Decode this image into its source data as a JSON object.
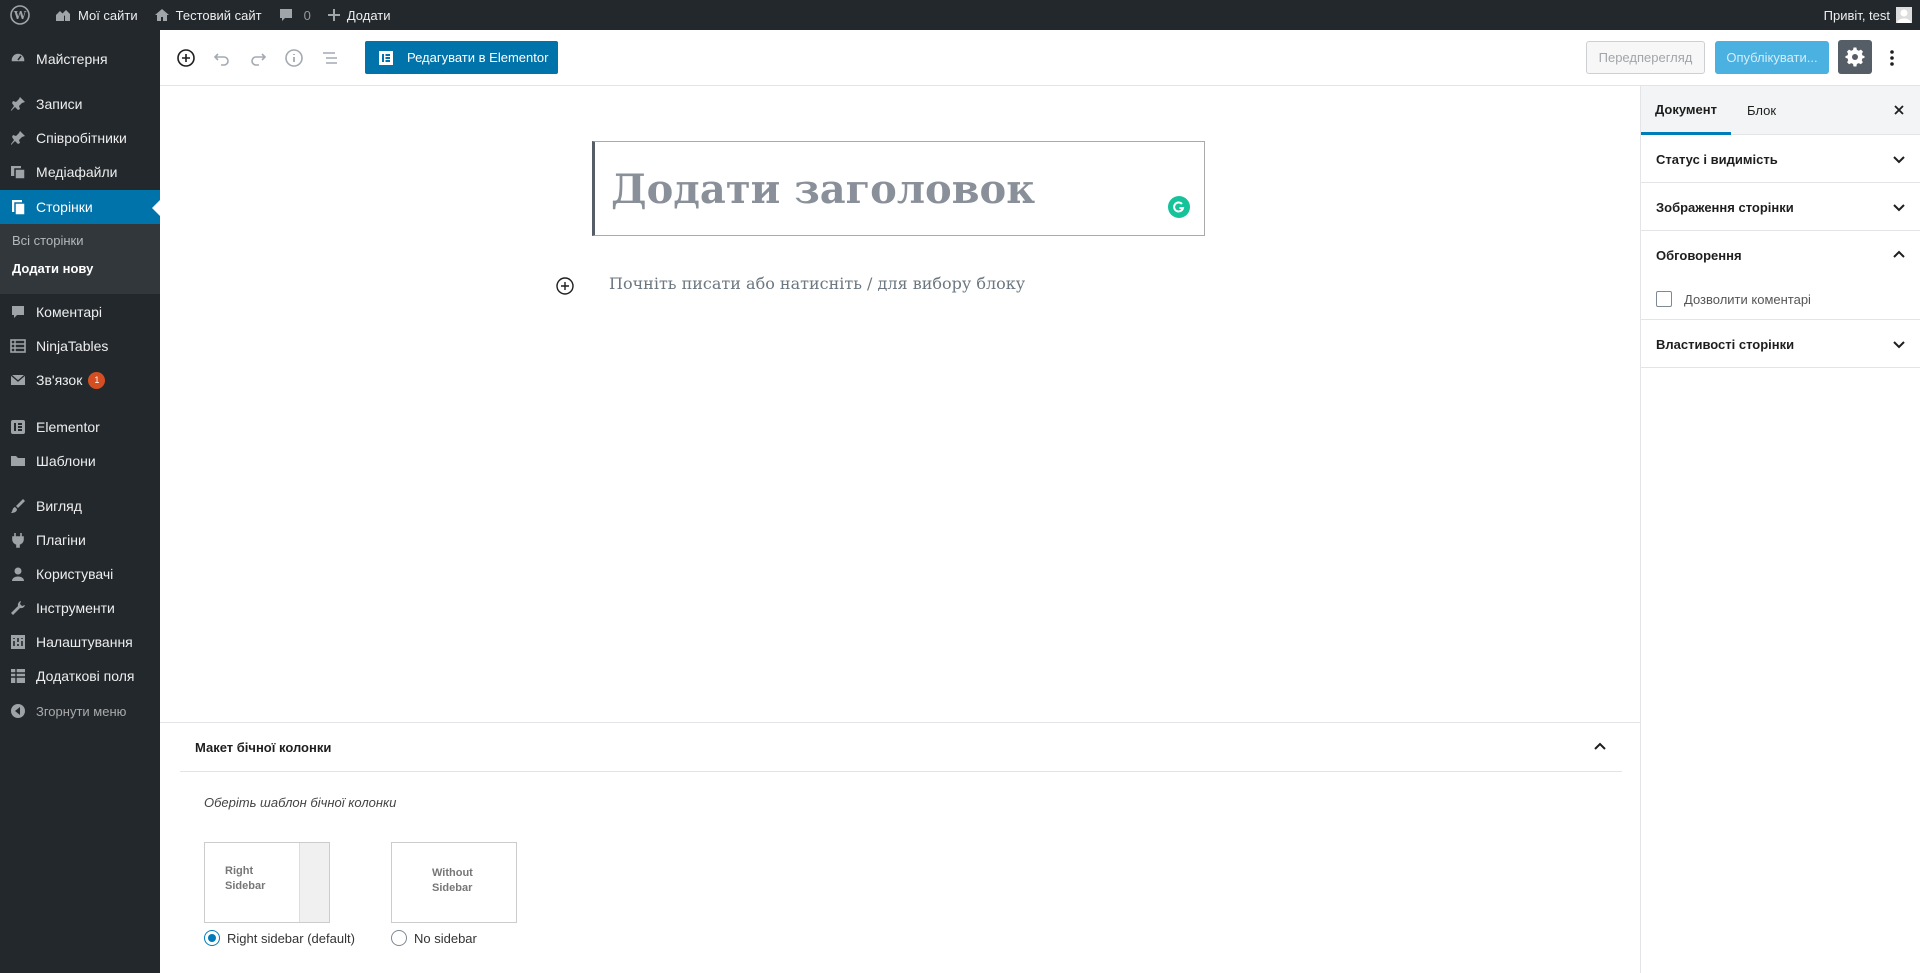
{
  "admin_bar": {
    "my_sites": "Мої сайти",
    "site_name": "Тестовий сайт",
    "comments_count": "0",
    "new_label": "Додати",
    "greeting": "Привіт, test"
  },
  "admin_menu": {
    "items": [
      {
        "label": "Майстерня",
        "icon": "dashboard-icon"
      },
      {
        "label": "Записи",
        "icon": "pin-icon"
      },
      {
        "label": "Співробітники",
        "icon": "pin-icon"
      },
      {
        "label": "Медіафайли",
        "icon": "media-icon"
      },
      {
        "label": "Сторінки",
        "icon": "pages-icon"
      },
      {
        "label": "Коментарі",
        "icon": "comment-icon"
      },
      {
        "label": "NinjaTables",
        "icon": "table-icon"
      },
      {
        "label": "Зв'язок",
        "icon": "mail-icon",
        "badge": "1"
      },
      {
        "label": "Elementor",
        "icon": "elementor-icon"
      },
      {
        "label": "Шаблони",
        "icon": "folder-icon"
      },
      {
        "label": "Вигляд",
        "icon": "brush-icon"
      },
      {
        "label": "Плагіни",
        "icon": "plugin-icon"
      },
      {
        "label": "Користувачі",
        "icon": "user-icon"
      },
      {
        "label": "Інструменти",
        "icon": "wrench-icon"
      },
      {
        "label": "Налаштування",
        "icon": "settings-icon"
      },
      {
        "label": "Додаткові поля",
        "icon": "grid-icon"
      }
    ],
    "submenu": {
      "all_pages": "Всі сторінки",
      "add_new": "Додати нову"
    },
    "collapse": "Згорнути меню"
  },
  "toolbar": {
    "elementor_button": "Редагувати в Elementor",
    "preview": "Передперегляд",
    "publish": "Опублікувати..."
  },
  "editor": {
    "title_placeholder": "Додати заголовок",
    "block_placeholder": "Почніть писати або натисніть / для вибору блоку"
  },
  "sidebar_layout_box": {
    "title": "Макет бічної колонки",
    "description": "Оберіть шаблон бічної колонки",
    "options": [
      {
        "card_label_line1": "Right",
        "card_label_line2": "Sidebar",
        "radio_label": "Right sidebar (default)",
        "selected": true
      },
      {
        "card_label_line1": "Without",
        "card_label_line2": "Sidebar",
        "radio_label": "No sidebar",
        "selected": false
      }
    ]
  },
  "settings_sidebar": {
    "tabs": [
      "Документ",
      "Блок"
    ],
    "active_tab": "Документ",
    "panels": {
      "status": "Статус і видимість",
      "featured_image": "Зображення сторінки",
      "discussion": "Обговорення",
      "allow_comments": "Дозволити коментарі",
      "page_attributes": "Властивості сторінки"
    }
  },
  "colors": {
    "admin_dark": "#23282d",
    "accent_blue": "#0073aa",
    "publish_disabled": "#4ab1e0",
    "notification_red": "#d54e21",
    "grammarly_green": "#15c39a"
  }
}
